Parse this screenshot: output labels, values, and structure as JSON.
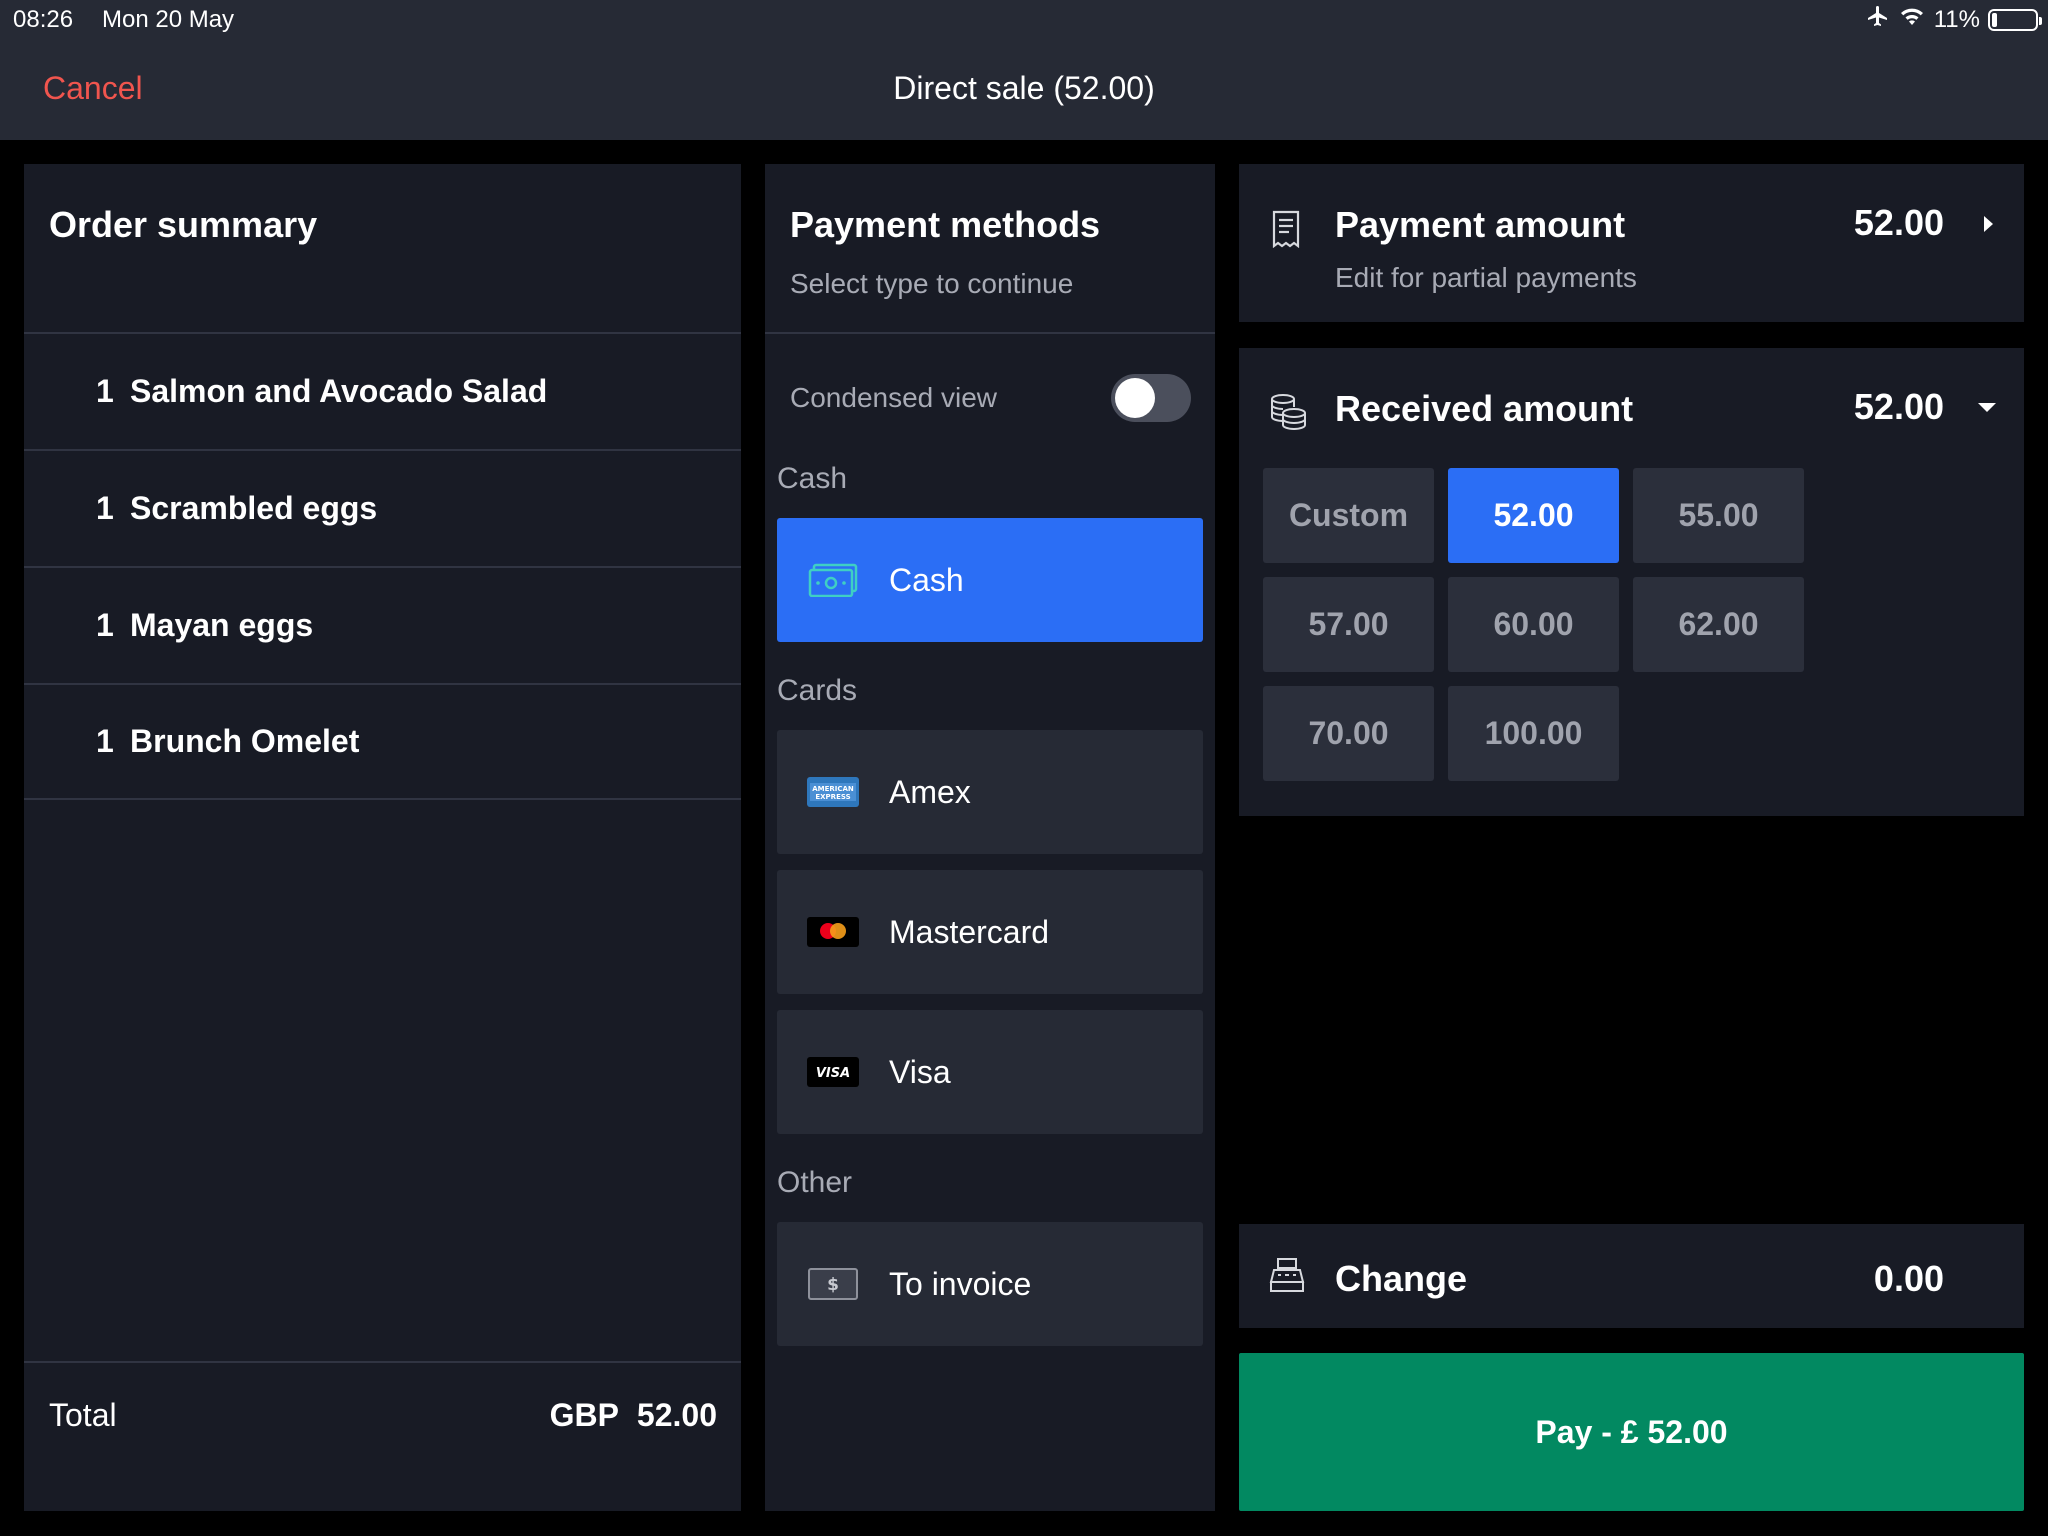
{
  "status_bar": {
    "time": "08:26",
    "date": "Mon 20 May",
    "battery": "11%",
    "battery_level": 0.11
  },
  "nav": {
    "cancel_label": "Cancel",
    "title": "Direct sale (52.00)"
  },
  "order_summary": {
    "title": "Order summary",
    "items": [
      {
        "qty": "1",
        "name": "Salmon and Avocado Salad"
      },
      {
        "qty": "1",
        "name": "Scrambled eggs"
      },
      {
        "qty": "1",
        "name": "Mayan eggs"
      },
      {
        "qty": "1",
        "name": "Brunch Omelet"
      }
    ],
    "total_label": "Total",
    "total_currency": "GBP",
    "total_value": "52.00"
  },
  "payment_methods": {
    "title": "Payment methods",
    "subtitle": "Select type to continue",
    "condensed_label": "Condensed view",
    "condensed_on": false,
    "sections": {
      "cash": "Cash",
      "cards": "Cards",
      "other": "Other"
    },
    "methods": {
      "cash": "Cash",
      "amex": "Amex",
      "mastercard": "Mastercard",
      "visa": "Visa",
      "invoice": "To invoice"
    },
    "icon_text": {
      "amex_top": "AMERICAN",
      "amex_bottom": "EXPRESS",
      "visa": "VISA",
      "invoice": "$"
    },
    "selected": "cash"
  },
  "payment_amount": {
    "title": "Payment amount",
    "subtitle": "Edit for partial payments",
    "value": "52.00",
    "icon": "receipt-icon"
  },
  "received_amount": {
    "title": "Received amount",
    "value": "52.00",
    "icon": "coins-icon",
    "options": [
      "Custom",
      "52.00",
      "55.00",
      "57.00",
      "60.00",
      "62.00",
      "70.00",
      "100.00"
    ],
    "selected": "52.00"
  },
  "change": {
    "title": "Change",
    "value": "0.00",
    "icon": "cash-register-icon"
  },
  "pay_button": {
    "label": "Pay - £ 52.00"
  },
  "colors": {
    "accent": "#2b6ef5",
    "pay": "#028961",
    "cancel": "#f0554e",
    "panel": "#181b25",
    "tile": "#262a35"
  }
}
